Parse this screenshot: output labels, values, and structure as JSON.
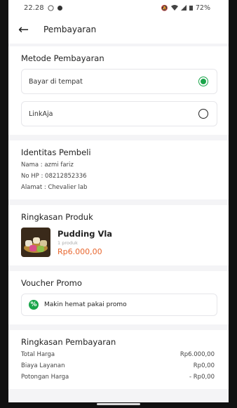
{
  "status_bar": {
    "time": "22.28",
    "battery": "72%"
  },
  "header": {
    "title": "Pembayaran"
  },
  "payment": {
    "title": "Metode Pembayaran",
    "options": [
      {
        "label": "Bayar di tempat",
        "selected": true
      },
      {
        "label": "LinkAja",
        "selected": false
      }
    ]
  },
  "buyer": {
    "title": "Identitas Pembeli",
    "name_line": "Nama : azmi fariz",
    "phone_line": "No HP : 08212852336",
    "address_line": "Alamat : Chevalier lab"
  },
  "product_summary": {
    "title": "Ringkasan Produk",
    "name": "Pudding Vla",
    "qty": "1 produk",
    "price": "Rp6.000,00"
  },
  "voucher": {
    "title": "Voucher Promo",
    "button_label": "Makin hemat pakai promo"
  },
  "payment_summary": {
    "title": "Ringkasan Pembayaran",
    "rows": [
      {
        "label": "Total Harga",
        "value": "Rp6.000,00"
      },
      {
        "label": "Biaya Layanan",
        "value": "Rp0,00"
      },
      {
        "label": "Potongan Harga",
        "value": "- Rp0,00"
      }
    ]
  },
  "colors": {
    "accent_green": "#1aa54a",
    "price_orange": "#e8662e"
  }
}
